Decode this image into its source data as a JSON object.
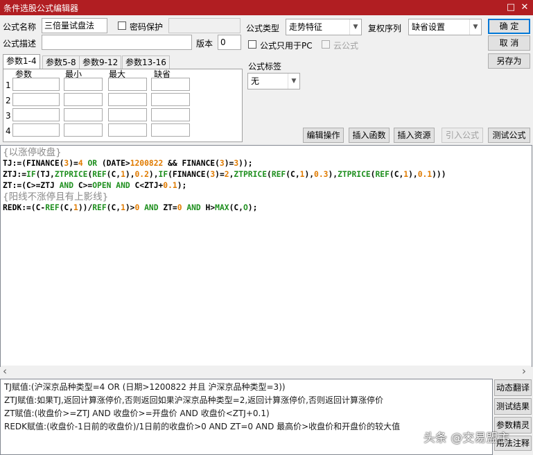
{
  "window": {
    "title": "条件选股公式编辑器",
    "minimize_glyph": "□",
    "close_glyph": "✕"
  },
  "form": {
    "name_label": "公式名称",
    "name_value": "三倍量试盘法",
    "password_label": "密码保护",
    "password_value": "",
    "desc_label": "公式描述",
    "desc_value": "",
    "version_label": "版本",
    "version_value": "0",
    "type_label": "公式类型",
    "type_value": "走势特征",
    "rights_label": "复权序列",
    "rights_value": "缺省设置",
    "pc_only_label": "公式只用于PC",
    "cloud_label": "云公式",
    "tag_label": "公式标签",
    "tag_value": "无"
  },
  "buttons": {
    "ok": "确  定",
    "cancel": "取  消",
    "save_as": "另存为",
    "edit_ops": "编辑操作",
    "insert_func": "插入函数",
    "insert_resource": "插入资源",
    "import_formula": "引入公式",
    "test_formula": "测试公式"
  },
  "params": {
    "tabs": [
      "参数1-4",
      "参数5-8",
      "参数9-12",
      "参数13-16"
    ],
    "headers": [
      "参数",
      "最小",
      "最大",
      "缺省"
    ],
    "rows": [
      "1",
      "2",
      "3",
      "4"
    ]
  },
  "code_lines": [
    [
      [
        "c-cmt",
        "{以涨停收盘}"
      ]
    ],
    [
      [
        "c-plain",
        "TJ:=(FINANCE("
      ],
      [
        "c-num",
        "3"
      ],
      [
        "c-plain",
        ")="
      ],
      [
        "c-num",
        "4"
      ],
      [
        "c-kw",
        " OR "
      ],
      [
        "c-plain",
        "(DATE>"
      ],
      [
        "c-num",
        "1200822"
      ],
      [
        "c-plain",
        " && FINANCE("
      ],
      [
        "c-num",
        "3"
      ],
      [
        "c-plain",
        ")="
      ],
      [
        "c-num",
        "3"
      ],
      [
        "c-plain",
        "));"
      ]
    ],
    [
      [
        "c-plain",
        "ZTJ:="
      ],
      [
        "c-kw",
        "IF"
      ],
      [
        "c-plain",
        "(TJ,"
      ],
      [
        "c-kw",
        "ZTPRICE"
      ],
      [
        "c-plain",
        "("
      ],
      [
        "c-kw",
        "REF"
      ],
      [
        "c-plain",
        "(C,"
      ],
      [
        "c-num",
        "1"
      ],
      [
        "c-plain",
        "),"
      ],
      [
        "c-num",
        "0.2"
      ],
      [
        "c-plain",
        "),"
      ],
      [
        "c-kw",
        "IF"
      ],
      [
        "c-plain",
        "(FINANCE("
      ],
      [
        "c-num",
        "3"
      ],
      [
        "c-plain",
        ")="
      ],
      [
        "c-num",
        "2"
      ],
      [
        "c-plain",
        ","
      ],
      [
        "c-kw",
        "ZTPRICE"
      ],
      [
        "c-plain",
        "("
      ],
      [
        "c-kw",
        "REF"
      ],
      [
        "c-plain",
        "(C,"
      ],
      [
        "c-num",
        "1"
      ],
      [
        "c-plain",
        "),"
      ],
      [
        "c-num",
        "0.3"
      ],
      [
        "c-plain",
        "),"
      ],
      [
        "c-kw",
        "ZTPRICE"
      ],
      [
        "c-plain",
        "("
      ],
      [
        "c-kw",
        "REF"
      ],
      [
        "c-plain",
        "(C,"
      ],
      [
        "c-num",
        "1"
      ],
      [
        "c-plain",
        "),"
      ],
      [
        "c-num",
        "0.1"
      ],
      [
        "c-plain",
        ")))"
      ]
    ],
    [
      [
        "c-plain",
        "ZT:=(C>=ZTJ "
      ],
      [
        "c-kw",
        "AND"
      ],
      [
        "c-plain",
        " C>="
      ],
      [
        "c-kw",
        "OPEN"
      ],
      [
        "c-kw",
        " AND "
      ],
      [
        "c-plain",
        "C<ZTJ+"
      ],
      [
        "c-num",
        "0.1"
      ],
      [
        "c-plain",
        ");"
      ]
    ],
    [
      [
        "c-cmt",
        "{阳线不涨停且有上影线}"
      ]
    ],
    [
      [
        "c-plain",
        "REDK:=(C-"
      ],
      [
        "c-kw",
        "REF"
      ],
      [
        "c-plain",
        "(C,"
      ],
      [
        "c-num",
        "1"
      ],
      [
        "c-plain",
        "))/"
      ],
      [
        "c-kw",
        "REF"
      ],
      [
        "c-plain",
        "(C,"
      ],
      [
        "c-num",
        "1"
      ],
      [
        "c-plain",
        ")>"
      ],
      [
        "c-num",
        "0"
      ],
      [
        "c-kw",
        " AND "
      ],
      [
        "c-plain",
        "ZT="
      ],
      [
        "c-num",
        "0"
      ],
      [
        "c-kw",
        " AND "
      ],
      [
        "c-plain",
        "H>"
      ],
      [
        "c-kw",
        "MAX"
      ],
      [
        "c-plain",
        "(C,"
      ],
      [
        "c-kw",
        "O"
      ],
      [
        "c-plain",
        ");"
      ]
    ]
  ],
  "description_lines": [
    "TJ赋值:(沪深京品种类型=4 OR (日期>1200822 并且 沪深京品种类型=3))",
    "ZTJ赋值:如果TJ,返回计算涨停价,否则返回如果沪深京品种类型=2,返回计算涨停价,否则返回计算涨停价",
    "ZT赋值:(收盘价>=ZTJ AND 收盘价>=开盘价 AND 收盘价<ZTJ+0.1)",
    "REDK赋值:(收盘价-1日前的收盘价)/1日前的收盘价>0 AND ZT=0 AND 最高价>收盘价和开盘价的较大值"
  ],
  "side_buttons": [
    "动态翻译",
    "测试结果",
    "参数精灵",
    "用法注释"
  ],
  "watermark": "头条 @交易盟主",
  "colors": {
    "title_bar": "#b11e22",
    "keyword": "#1e8f1e",
    "number": "#e07b00",
    "comment": "#8a8a8a"
  },
  "icons": {
    "scroll_left": "‹",
    "scroll_right": "›"
  }
}
